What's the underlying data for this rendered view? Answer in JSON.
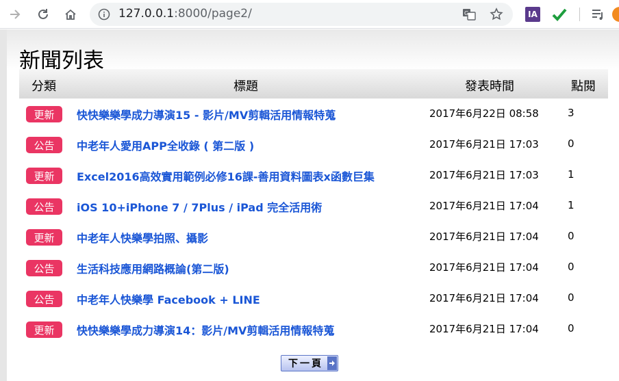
{
  "browser": {
    "url_host": "127.0.0.1",
    "url_rest": ":8000/page2/",
    "ext_ia_label": "IA"
  },
  "page": {
    "title": "新聞列表",
    "headers": {
      "category": "分類",
      "title": "標題",
      "date": "發表時間",
      "views": "點閱"
    },
    "rows": [
      {
        "category": "更新",
        "title": "快快樂樂學成力導演15 - 影片/MV剪輯活用情報特蒐",
        "date": "2017年6月22日 08:58",
        "views": "3"
      },
      {
        "category": "公告",
        "title": "中老年人愛用APP全收錄 ( 第二版 )",
        "date": "2017年6月21日 17:03",
        "views": "0"
      },
      {
        "category": "更新",
        "title": "Excel2016高效實用範例必修16課-善用資料圖表x函數巨集",
        "date": "2017年6月21日 17:03",
        "views": "1"
      },
      {
        "category": "公告",
        "title": "iOS 10+iPhone 7 / 7Plus / iPad 完全活用術",
        "date": "2017年6月21日 17:04",
        "views": "1"
      },
      {
        "category": "更新",
        "title": "中老年人快樂學拍照、攝影",
        "date": "2017年6月21日 17:04",
        "views": "0"
      },
      {
        "category": "公告",
        "title": "生活科技應用網路概論(第二版)",
        "date": "2017年6月21日 17:04",
        "views": "0"
      },
      {
        "category": "公告",
        "title": "中老年人快樂學 Facebook + LINE",
        "date": "2017年6月21日 17:04",
        "views": "0"
      },
      {
        "category": "更新",
        "title": "快快樂樂學成力導演14：影片/MV剪輯活用情報特蒐",
        "date": "2017年6月21日 17:04",
        "views": "0"
      }
    ],
    "next_label": "下一頁"
  },
  "icons": {
    "forward": "forward-arrow-icon",
    "reload": "reload-icon",
    "home": "home-icon",
    "info": "info-icon",
    "translate": "translate-icon",
    "bookmark": "star-icon",
    "check": "check-icon",
    "queue": "queue-icon"
  },
  "colors": {
    "badge": "#ea3563",
    "link": "#1a56d6",
    "next_button": "#5a74c6"
  }
}
